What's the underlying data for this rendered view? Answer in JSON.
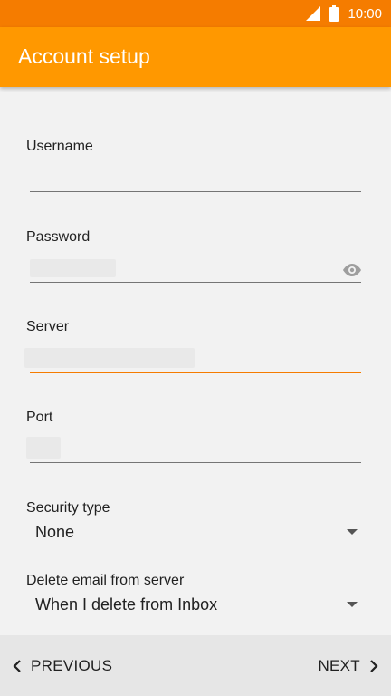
{
  "status_bar": {
    "time": "10:00",
    "icons": [
      "signal-icon",
      "battery-icon"
    ]
  },
  "app_bar": {
    "title": "Account setup"
  },
  "form": {
    "username": {
      "label": "Username",
      "value": ""
    },
    "password": {
      "label": "Password",
      "value": ""
    },
    "server": {
      "label": "Server",
      "value": ""
    },
    "port": {
      "label": "Port",
      "value": ""
    },
    "security_type": {
      "label": "Security type",
      "value": "None"
    },
    "delete_email": {
      "label": "Delete email from server",
      "value": "When I delete from Inbox"
    }
  },
  "navigation": {
    "previous_label": "PREVIOUS",
    "next_label": "NEXT"
  },
  "colors": {
    "status_bar": "#f57c00",
    "app_bar": "#ff9800",
    "accent": "#f57c00",
    "background": "#f2f2f2",
    "bottom_bar": "#e6e6e6"
  }
}
